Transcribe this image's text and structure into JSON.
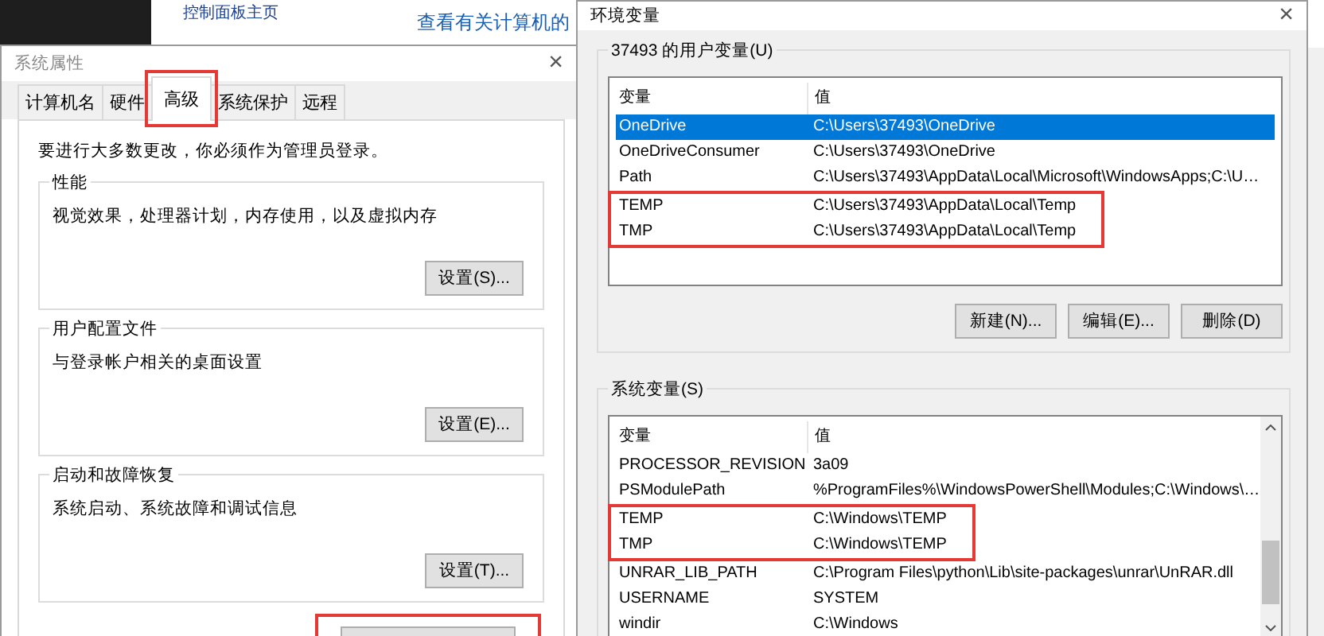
{
  "background_window": {
    "sidebar_link": "控制面板主页",
    "heading": "查看有关计算机的"
  },
  "system_properties": {
    "title": "系统属性",
    "close": "×",
    "tabs": [
      {
        "label": "计算机名",
        "selected": false,
        "highlighted": false
      },
      {
        "label": "硬件",
        "selected": false,
        "highlighted": false
      },
      {
        "label": "高级",
        "selected": true,
        "highlighted": true
      },
      {
        "label": "系统保护",
        "selected": false,
        "highlighted": false
      },
      {
        "label": "远程",
        "selected": false,
        "highlighted": false
      }
    ],
    "notice": "要进行大多数更改，你必须作为管理员登录。",
    "groups": [
      {
        "title": "性能",
        "description": "视觉效果，处理器计划，内存使用，以及虚拟内存",
        "button": "设置(S)..."
      },
      {
        "title": "用户配置文件",
        "description": "与登录帐户相关的桌面设置",
        "button": "设置(E)..."
      },
      {
        "title": "启动和故障恢复",
        "description": "系统启动、系统故障和调试信息",
        "button": "设置(T)..."
      }
    ],
    "environment_button": {
      "highlighted": true
    }
  },
  "environment_variables": {
    "title": "环境变量",
    "close": "×",
    "user_group": {
      "title": "37493 的用户变量(U)",
      "columns": [
        "变量",
        "值"
      ],
      "rows": [
        {
          "name": "OneDrive",
          "value": "C:\\Users\\37493\\OneDrive",
          "selected": true,
          "highlighted": false
        },
        {
          "name": "OneDriveConsumer",
          "value": "C:\\Users\\37493\\OneDrive",
          "selected": false,
          "highlighted": false
        },
        {
          "name": "Path",
          "value": "C:\\Users\\37493\\AppData\\Local\\Microsoft\\WindowsApps;C:\\U…",
          "selected": false,
          "highlighted": false
        },
        {
          "name": "TEMP",
          "value": "C:\\Users\\37493\\AppData\\Local\\Temp",
          "selected": false,
          "highlighted": true
        },
        {
          "name": "TMP",
          "value": "C:\\Users\\37493\\AppData\\Local\\Temp",
          "selected": false,
          "highlighted": true
        }
      ],
      "buttons": [
        "新建(N)...",
        "编辑(E)...",
        "删除(D)"
      ]
    },
    "system_group": {
      "title": "系统变量(S)",
      "columns": [
        "变量",
        "值"
      ],
      "rows": [
        {
          "name": "PROCESSOR_REVISION",
          "value": "3a09",
          "selected": false,
          "highlighted": false
        },
        {
          "name": "PSModulePath",
          "value": "%ProgramFiles%\\WindowsPowerShell\\Modules;C:\\Windows\\…",
          "selected": false,
          "highlighted": false
        },
        {
          "name": "TEMP",
          "value": "C:\\Windows\\TEMP",
          "selected": false,
          "highlighted": true
        },
        {
          "name": "TMP",
          "value": "C:\\Windows\\TEMP",
          "selected": false,
          "highlighted": true
        },
        {
          "name": "UNRAR_LIB_PATH",
          "value": "C:\\Program Files\\python\\Lib\\site-packages\\unrar\\UnRAR.dll",
          "selected": false,
          "highlighted": false
        },
        {
          "name": "USERNAME",
          "value": "SYSTEM",
          "selected": false,
          "highlighted": false
        },
        {
          "name": "windir",
          "value": "C:\\Windows",
          "selected": false,
          "highlighted": false
        }
      ]
    }
  }
}
